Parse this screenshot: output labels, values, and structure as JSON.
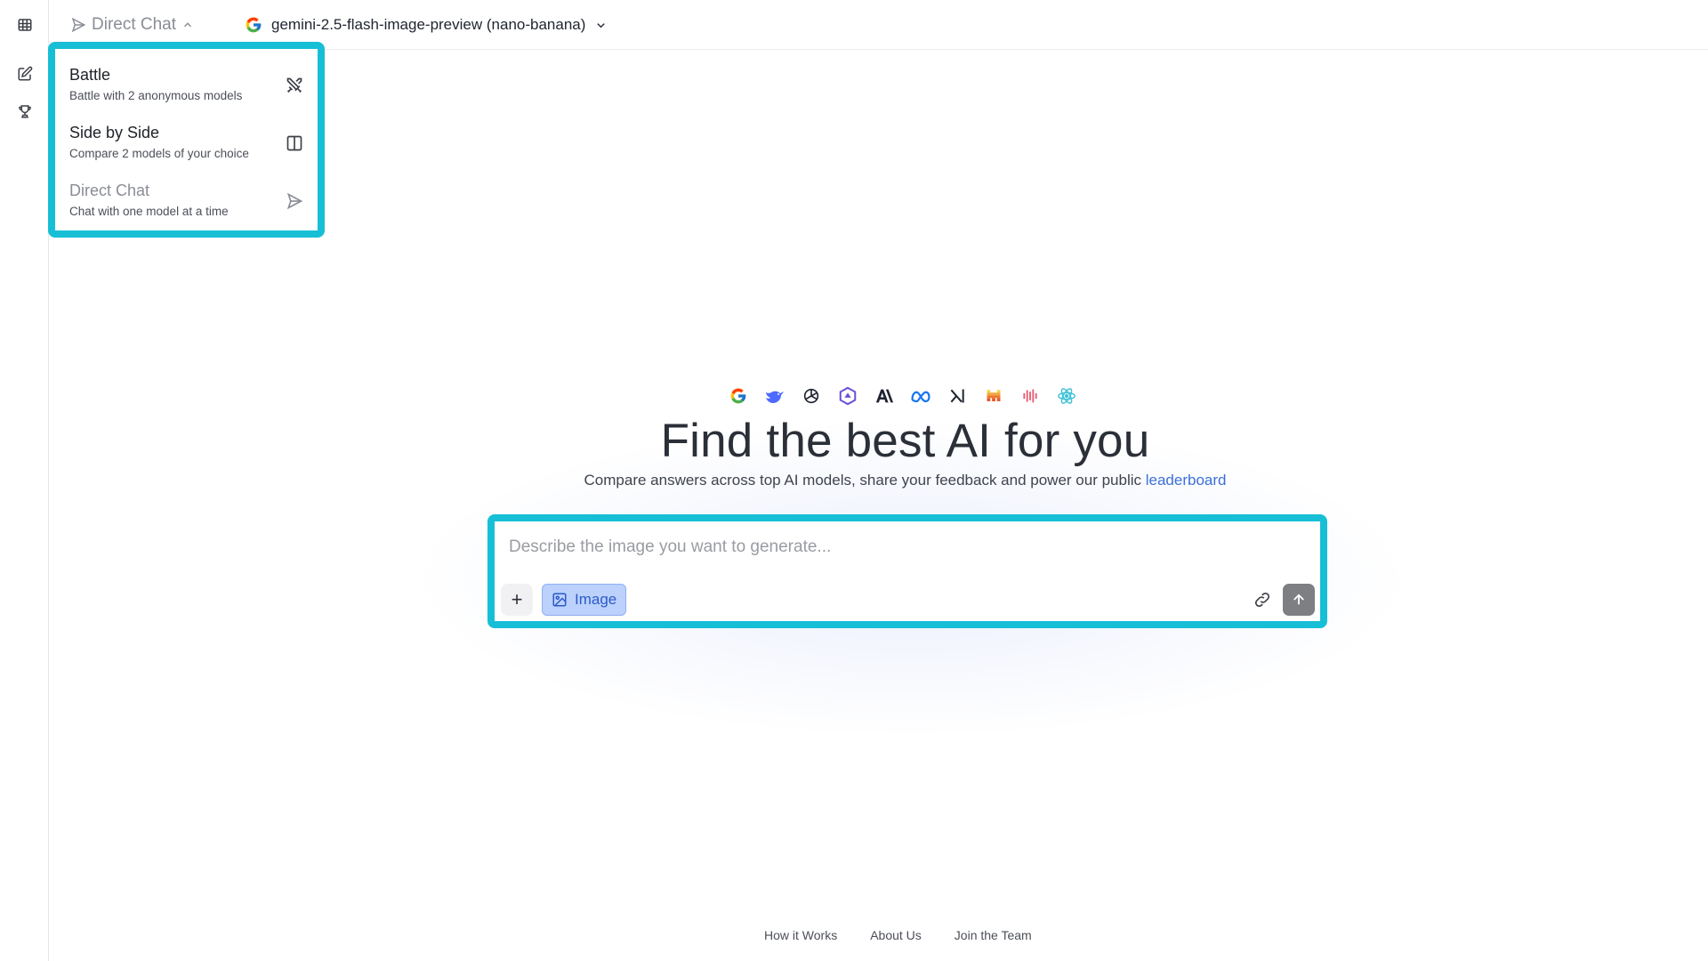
{
  "rail": {
    "items": [
      {
        "name": "leaderboard-table-icon"
      },
      {
        "name": "new-chat-icon"
      },
      {
        "name": "trophy-icon"
      }
    ]
  },
  "topbar": {
    "mode_label": "Direct Chat",
    "model_label": "gemini-2.5-flash-image-preview (nano-banana)"
  },
  "menu": {
    "items": [
      {
        "title": "Battle",
        "desc": "Battle with 2 anonymous models",
        "icon": "crossed-swords-icon"
      },
      {
        "title": "Side by Side",
        "desc": "Compare 2 models of your choice",
        "icon": "split-panel-icon"
      },
      {
        "title": "Direct Chat",
        "desc": "Chat with one model at a time",
        "icon": "send-icon"
      }
    ]
  },
  "hero": {
    "title": "Find the best AI for you",
    "subtitle": "Compare answers across top AI models, share your feedback and power our public ",
    "subtitle_link": "leaderboard",
    "logos": [
      "google-logo",
      "deepseek-logo",
      "openai-logo",
      "qwen-logo",
      "anthropic-logo",
      "meta-logo",
      "xai-logo",
      "mistral-logo",
      "minimax-logo",
      "react-logo"
    ]
  },
  "prompt": {
    "placeholder": "Describe the image you want to generate...",
    "value": "",
    "image_label": "Image"
  },
  "footer": {
    "links": [
      "How it Works",
      "About Us",
      "Join the Team"
    ]
  },
  "colors": {
    "highlight": "#17bfd6",
    "link": "#3b6fd6",
    "image_chip_bg": "#bcd1fb"
  }
}
